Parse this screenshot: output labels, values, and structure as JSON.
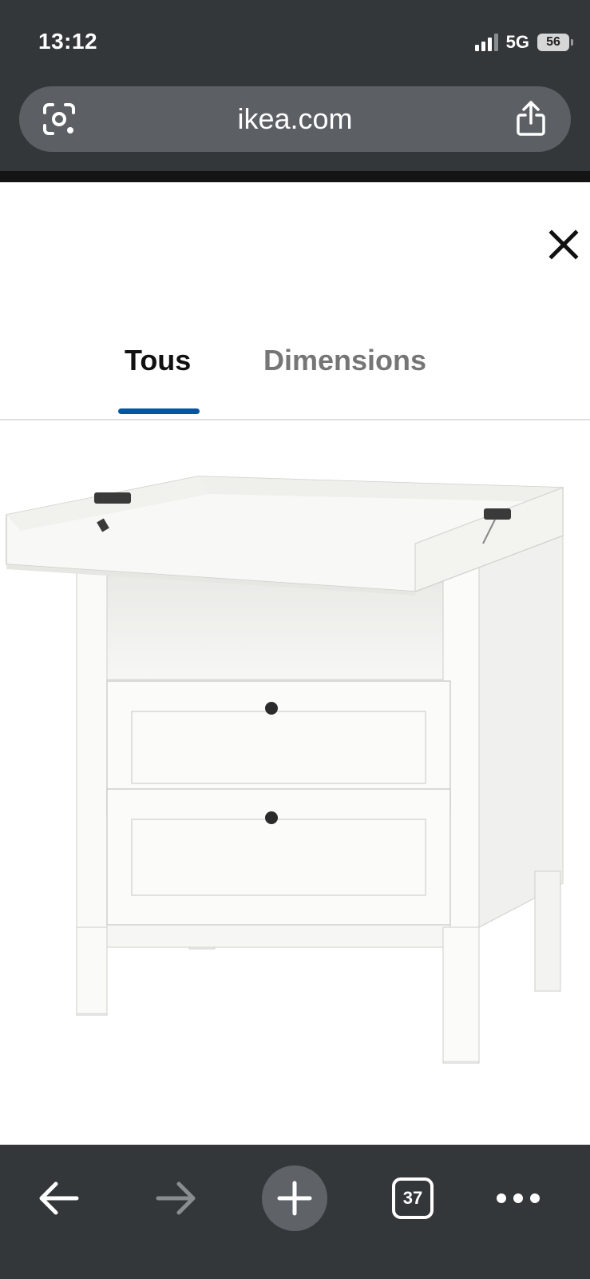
{
  "status_bar": {
    "time": "13:12",
    "network": "5G",
    "battery": "56"
  },
  "browser": {
    "url": "ikea.com",
    "tab_count": "37",
    "icons": {
      "lens": "google-lens-icon",
      "share": "share-icon",
      "back": "back-arrow-icon",
      "forward": "forward-arrow-icon",
      "new_tab": "plus-icon",
      "more": "more-dots-icon"
    }
  },
  "viewer": {
    "close_icon": "close-icon",
    "tabs": [
      {
        "label": "Tous",
        "active": true
      },
      {
        "label": "Dimensions",
        "active": false
      }
    ],
    "accent_color": "#0058a3"
  },
  "colors": {
    "chrome_background": "#34373a",
    "url_bar": "#5c6065",
    "active_tab_text": "#111111",
    "inactive_tab_text": "#767676"
  }
}
